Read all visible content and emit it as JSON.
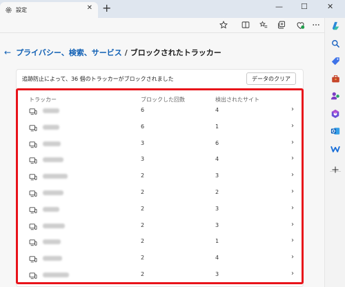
{
  "browser": {
    "tab_title": "設定",
    "tab_close": "✕",
    "new_tab": "+",
    "window_controls": [
      "—",
      "☐",
      "✕"
    ]
  },
  "page": {
    "back_arrow": "←",
    "breadcrumb_parent": "プライバシー、検索、サービス",
    "breadcrumb_separator": "/",
    "breadcrumb_current": "ブロックされたトラッカー",
    "summary": "追跡防止によって、36 個のトラッカーがブロックされました",
    "clear_button": "データのクリア",
    "columns": {
      "tracker": "トラッカー",
      "blocked_count": "ブロックした回数",
      "detected_sites": "検出されたサイト"
    },
    "trackers": [
      {
        "blocked": "6",
        "sites": "4"
      },
      {
        "blocked": "6",
        "sites": "1"
      },
      {
        "blocked": "3",
        "sites": "6"
      },
      {
        "blocked": "3",
        "sites": "4"
      },
      {
        "blocked": "2",
        "sites": "3"
      },
      {
        "blocked": "2",
        "sites": "2"
      },
      {
        "blocked": "2",
        "sites": "3"
      },
      {
        "blocked": "2",
        "sites": "3"
      },
      {
        "blocked": "2",
        "sites": "1"
      },
      {
        "blocked": "2",
        "sites": "4"
      },
      {
        "blocked": "2",
        "sites": "3"
      }
    ]
  },
  "colors": {
    "accent": "#0f5fb4",
    "highlight_frame": "#e8131a",
    "titlebar": "#dfe6ef"
  },
  "icons": {
    "toolbar": [
      "favorite-star-icon",
      "split-screen-icon",
      "favorites-list-icon",
      "collections-icon",
      "browser-essentials-icon",
      "more-icon"
    ],
    "sidebar": [
      "copilot-icon",
      "search-icon",
      "shopping-tag-icon",
      "tools-briefcase-icon",
      "people-icon",
      "office-icon",
      "outlook-icon",
      "drop-icon",
      "add-icon"
    ]
  }
}
